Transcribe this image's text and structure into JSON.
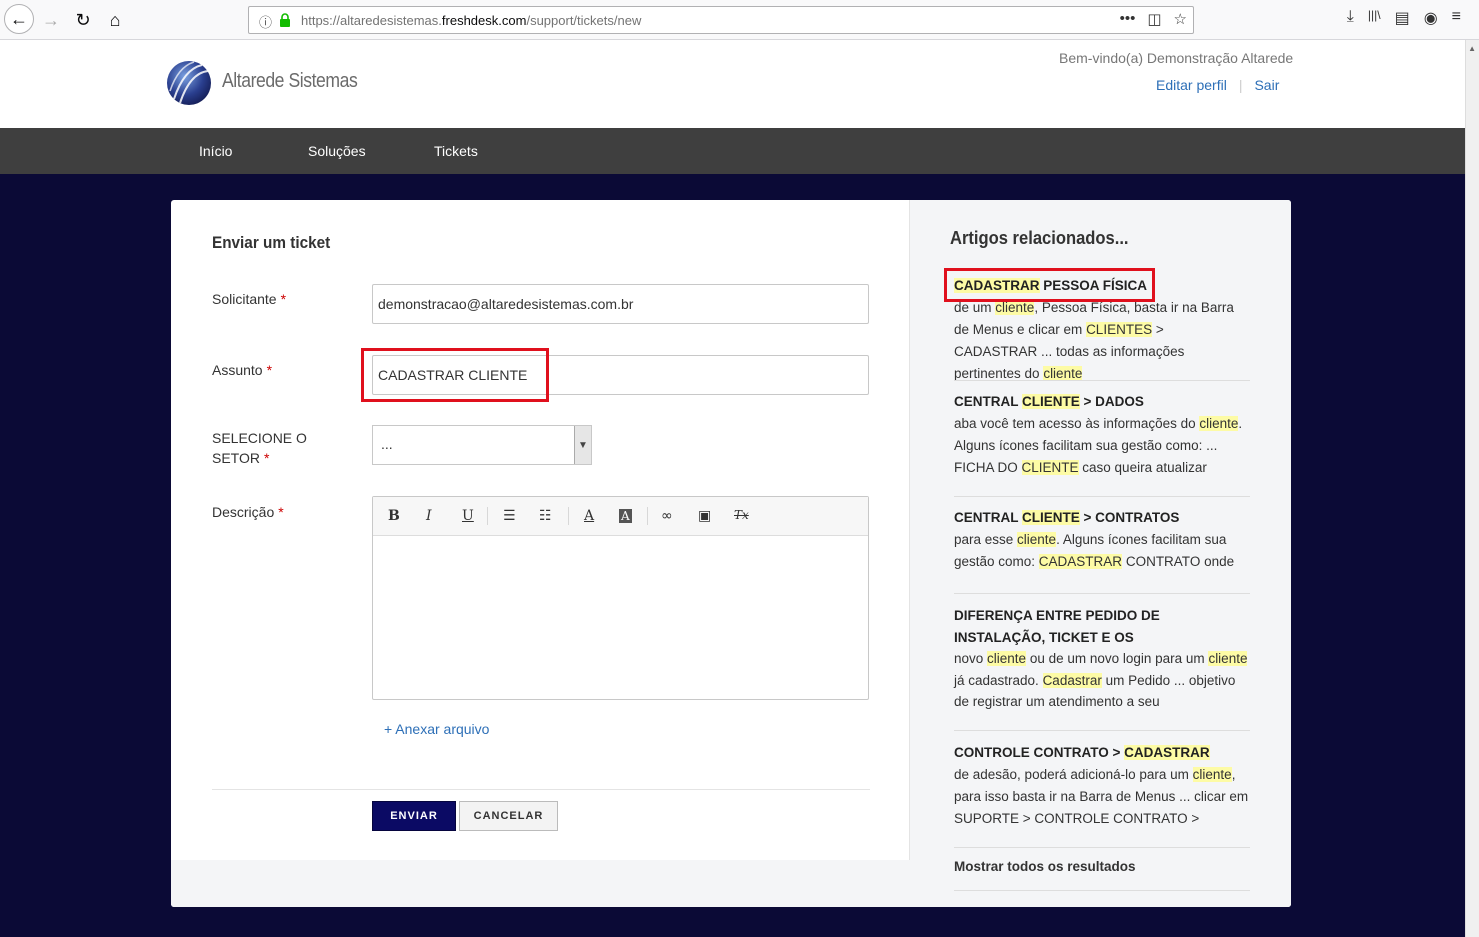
{
  "browser": {
    "url_host_prefix": "https://altaredesistemas.",
    "url_host_domain": "freshdesk.com",
    "url_path": "/support/tickets/new",
    "url_actions": [
      "•••",
      "◫",
      "☆"
    ],
    "toolbar_icons": [
      "⤓",
      "|||\\",
      "▤",
      "◉",
      "≡"
    ]
  },
  "header": {
    "brand": "Altarede Sistemas",
    "welcome": "Bem-vindo(a) Demonstração Altarede",
    "edit_profile": "Editar perfil",
    "logout": "Sair"
  },
  "nav": {
    "items": [
      "Início",
      "Soluções",
      "Tickets"
    ]
  },
  "form": {
    "title": "Enviar um ticket",
    "requester_label": "Solicitante",
    "requester_value": "demonstracao@altaredesistemas.com.br",
    "subject_label": "Assunto",
    "subject_value": "CADASTRAR CLIENTE",
    "sector_label_1": "SELECIONE O",
    "sector_label_2": "SETOR",
    "sector_value": "...",
    "description_label": "Descrição",
    "required_mark": "*",
    "toolbar": [
      "B",
      "I",
      "U",
      "☰",
      "☷",
      "A",
      "A",
      "∞",
      "▣",
      "Tx"
    ],
    "attach": "+ Anexar arquivo",
    "submit": "ENVIAR",
    "cancel": "CANCELAR"
  },
  "related": {
    "title": "Artigos relacionados...",
    "show_all": "Mostrar todos os resultados",
    "articles": [
      {
        "title_parts": [
          {
            "t": "CADASTRAR",
            "hl": true
          },
          {
            "t": " PESSOA FÍSICA",
            "hl": false
          }
        ],
        "snippet_parts": [
          {
            "t": "de um ",
            "hl": false
          },
          {
            "t": "cliente",
            "hl": true
          },
          {
            "t": ", Pessoa Física, basta ir na Barra de Menus e clicar em ",
            "hl": false
          },
          {
            "t": "CLIENTES",
            "hl": true
          },
          {
            "t": " > CADASTRAR ... todas as informações pertinentes do ",
            "hl": false
          },
          {
            "t": "cliente",
            "hl": true
          }
        ]
      },
      {
        "title_parts": [
          {
            "t": "CENTRAL ",
            "hl": false
          },
          {
            "t": "CLIENTE",
            "hl": true
          },
          {
            "t": " > DADOS",
            "hl": false
          }
        ],
        "snippet_parts": [
          {
            "t": "aba você tem acesso às informações do ",
            "hl": false
          },
          {
            "t": "cliente",
            "hl": true
          },
          {
            "t": ". Alguns ícones facilitam sua gestão como: ... FICHA DO ",
            "hl": false
          },
          {
            "t": "CLIENTE",
            "hl": true
          },
          {
            "t": " caso queira atualizar",
            "hl": false
          }
        ]
      },
      {
        "title_parts": [
          {
            "t": "CENTRAL ",
            "hl": false
          },
          {
            "t": "CLIENTE",
            "hl": true
          },
          {
            "t": " > CONTRATOS",
            "hl": false
          }
        ],
        "snippet_parts": [
          {
            "t": "para esse ",
            "hl": false
          },
          {
            "t": "cliente",
            "hl": true
          },
          {
            "t": ". Alguns ícones facilitam sua gestão como: ",
            "hl": false
          },
          {
            "t": "CADASTRAR",
            "hl": true
          },
          {
            "t": " CONTRATO onde",
            "hl": false
          }
        ]
      },
      {
        "title_parts": [
          {
            "t": "DIFERENÇA ENTRE PEDIDO DE INSTALAÇÃO, TICKET E OS",
            "hl": false
          }
        ],
        "snippet_parts": [
          {
            "t": "novo ",
            "hl": false
          },
          {
            "t": "cliente",
            "hl": true
          },
          {
            "t": " ou de um novo login para um ",
            "hl": false
          },
          {
            "t": "cliente",
            "hl": true
          },
          {
            "t": " já cadastrado. ",
            "hl": false
          },
          {
            "t": "Cadastrar",
            "hl": true
          },
          {
            "t": " um Pedido ... objetivo de registrar um atendimento a seu",
            "hl": false
          }
        ]
      },
      {
        "title_parts": [
          {
            "t": "CONTROLE CONTRATO > ",
            "hl": false
          },
          {
            "t": "CADASTRAR",
            "hl": true
          }
        ],
        "snippet_parts": [
          {
            "t": "de adesão, poderá adicioná-lo para um ",
            "hl": false
          },
          {
            "t": "cliente",
            "hl": true
          },
          {
            "t": ", para isso basta ir na Barra de Menus ... clicar em SUPORTE > CONTROLE CONTRATO >",
            "hl": false
          }
        ]
      }
    ]
  },
  "colors": {
    "nav_bg": "#3f3f3f",
    "page_bg": "#0b0a36",
    "submit_bg": "#0b0a64",
    "link": "#2d6fb7",
    "highlight": "#fdfba5",
    "annotation": "#e0101d"
  }
}
